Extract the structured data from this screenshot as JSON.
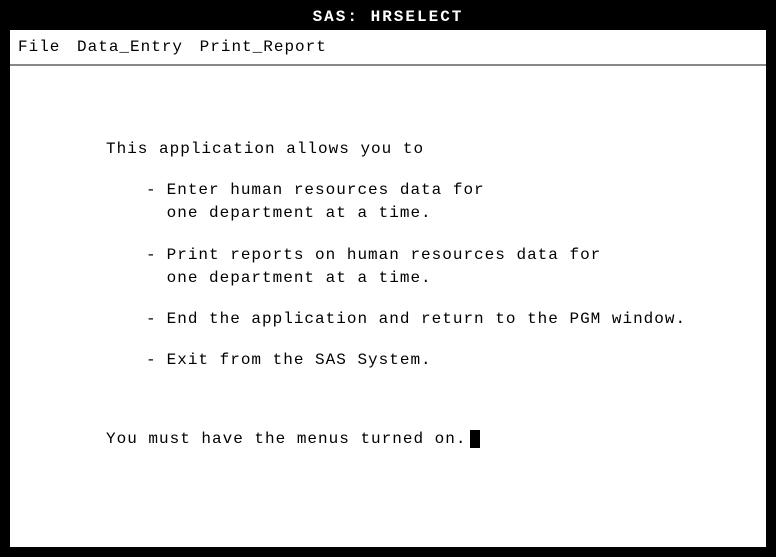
{
  "window": {
    "title": "SAS: HRSELECT"
  },
  "menu": {
    "items": [
      {
        "label": "File"
      },
      {
        "label": "Data_Entry"
      },
      {
        "label": "Print_Report"
      }
    ]
  },
  "content": {
    "intro": "This application allows you to",
    "bullets": [
      "Enter human resources data for\none department at a time.",
      "Print reports on human resources data for\none department at a time.",
      "End the application and return to the PGM window.",
      "Exit from the SAS System."
    ],
    "footer": "You must have the menus turned on."
  }
}
